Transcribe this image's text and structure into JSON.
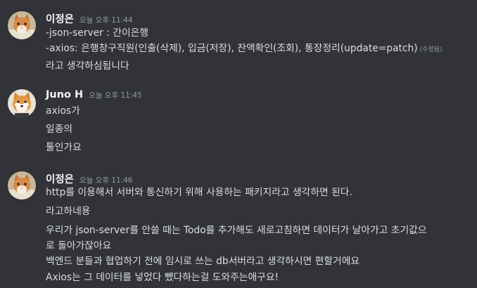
{
  "messages": [
    {
      "username": "이정은",
      "timestamp": "오늘 오후 11:44",
      "lines": [
        "-json-server : 간이은행",
        "-axios: 은행창구직원(인출(삭제), 입금(저장), 잔액확인(조회), 통장정리(update=patch)",
        "라고 생각하심됩니다"
      ],
      "edited_label": "(수정됨)"
    },
    {
      "username": "Juno H",
      "timestamp": "오늘 오후 11:45",
      "lines": [
        "axios가",
        "일종의",
        "툴인가요"
      ]
    },
    {
      "username": "이정은",
      "timestamp": "오늘 오후 11:46",
      "lines": [
        "http를 이용해서 서버와 통신하기 위해 사용하는 패키지라고 생각하면 된다.",
        "라고하네용",
        "우리가 json-server를 안쓸 때는 Todo를 추가해도 새로고침하면 데이터가 날아가고 초기값으",
        "로 돌아가잖아요",
        "백엔드 분들과 협업하기 전에 임시로 쓰는 db서버라고 생각하시면 편할거에요",
        "Axios는 그 데이터를 넣었다 뺐다하는걸 도와주는애구요!"
      ]
    }
  ],
  "colors": {
    "background": "#313338",
    "username": "#f2f3f5",
    "text": "#dbdee1",
    "muted": "#949ba4"
  },
  "icons": {
    "avatar_1": "cat-avatar-icon",
    "avatar_2": "shiba-dog-avatar-icon",
    "avatar_3": "cat-avatar-icon"
  }
}
